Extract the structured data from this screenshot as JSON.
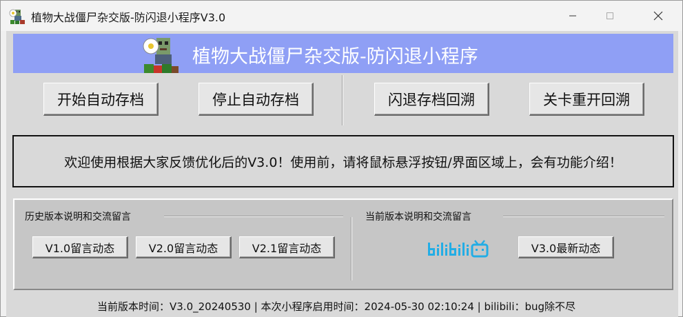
{
  "window": {
    "title": "植物大战僵尸杂交版-防闪退小程序V3.0",
    "minimize_icon": "minimize-icon",
    "maximize_icon": "maximize-icon",
    "close_icon": "close-icon"
  },
  "banner": {
    "title": "植物大战僵尸杂交版-防闪退小程序",
    "background": "#8f9ff5"
  },
  "main_buttons": {
    "start_autosave": "开始自动存档",
    "stop_autosave": "停止自动存档",
    "crash_rollback": "闪退存档回溯",
    "level_restart_rollback": "关卡重开回溯"
  },
  "welcome": {
    "message": "欢迎使用根据大家反馈优化后的V3.0！使用前，请将鼠标悬浮按钮/界面区域上，会有功能介绍！"
  },
  "history_group": {
    "title": "历史版本说明和交流留言",
    "buttons": [
      "V1.0留言动态",
      "V2.0留言动态",
      "V2.1留言动态"
    ]
  },
  "current_group": {
    "title": "当前版本说明和交流留言",
    "logo_icon": "bilibili-logo-icon",
    "logo_color": "#23ade5",
    "latest_button": "V3.0最新动态"
  },
  "footer": {
    "status": "当前版本时间：V3.0_20240530 | 本次小程序启用时间：2024-05-30 02:10:24  | bilibili：bug除不尽"
  }
}
